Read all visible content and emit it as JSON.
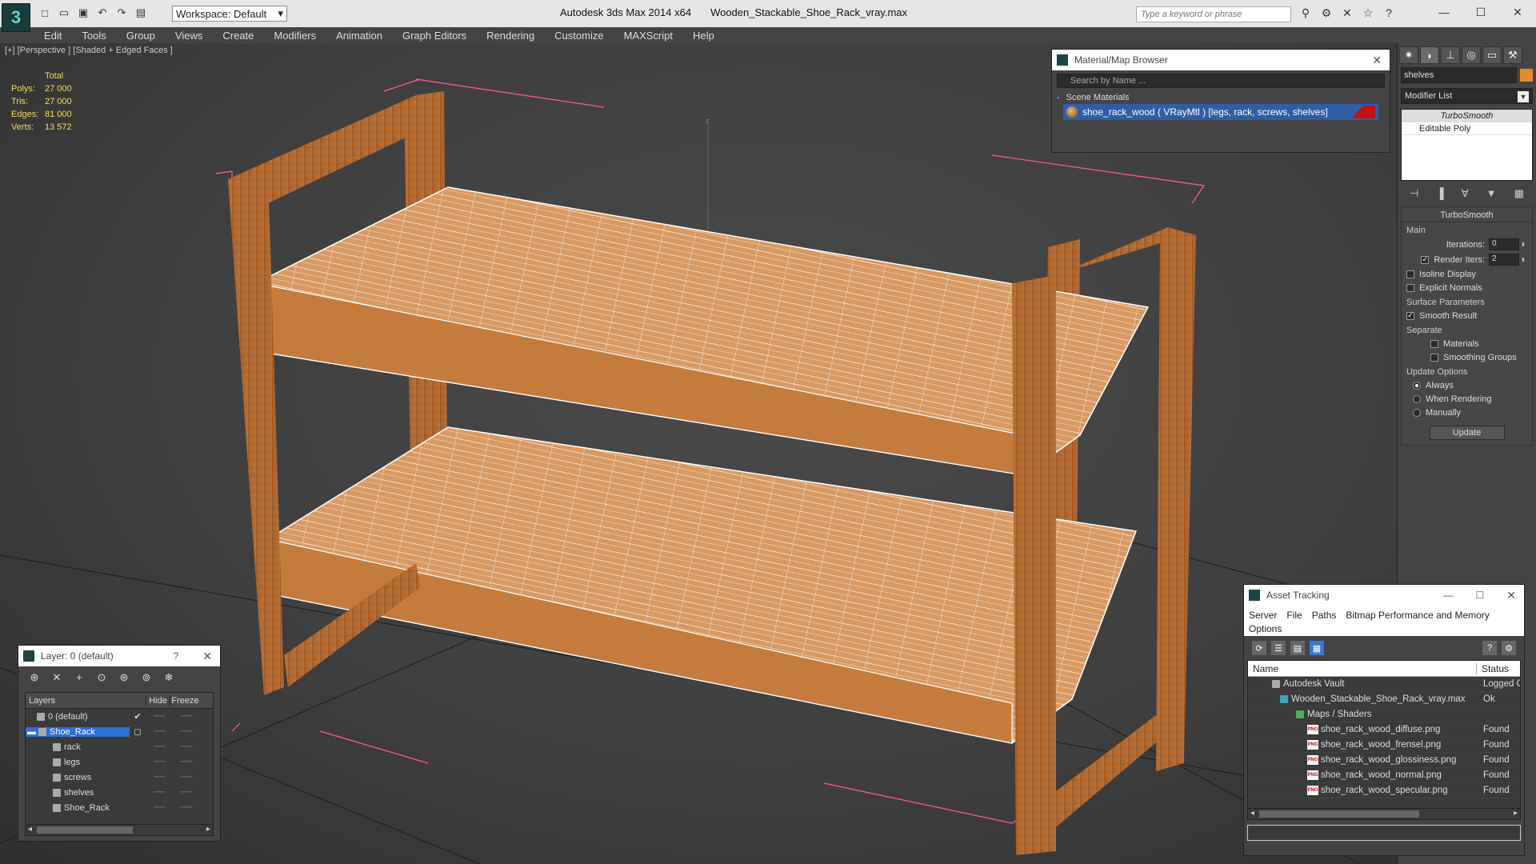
{
  "app": {
    "title": "Autodesk 3ds Max  2014 x64",
    "file": "Wooden_Stackable_Shoe_Rack_vray.max",
    "workspace": "Workspace: Default",
    "search_placeholder": "Type a keyword or phrase",
    "logo_glyph": "3"
  },
  "menu": [
    "Edit",
    "Tools",
    "Group",
    "Views",
    "Create",
    "Modifiers",
    "Animation",
    "Graph Editors",
    "Rendering",
    "Customize",
    "MAXScript",
    "Help"
  ],
  "viewport": {
    "label": "[+] [Perspective ] [Shaded + Edged Faces ]",
    "axis_label": "z",
    "stats": {
      "header": "Total",
      "rows": [
        {
          "k": "Polys:",
          "v": "27 000"
        },
        {
          "k": "Tris:",
          "v": "27 000"
        },
        {
          "k": "Edges:",
          "v": "81 000"
        },
        {
          "k": "Verts:",
          "v": "13 572"
        }
      ]
    }
  },
  "material_browser": {
    "title": "Material/Map Browser",
    "search": "Search by Name ...",
    "section": "Scene Materials",
    "material": "shoe_rack_wood  ( VRayMtl ) [legs, rack, screws, shelves]"
  },
  "command_panel": {
    "object_name": "shelves",
    "object_color": "#e58a2c",
    "modifier_list": "Modifier List",
    "stack": [
      "TurboSmooth",
      "Editable Poly"
    ],
    "turbosmooth": {
      "title": "TurboSmooth",
      "main": "Main",
      "iterations_label": "Iterations:",
      "iterations": "0",
      "render_iters_label": "Render Iters:",
      "render_iters": "2",
      "isoline": "Isoline Display",
      "explicit": "Explicit Normals",
      "surface": "Surface Parameters",
      "smooth_result": "Smooth Result",
      "separate": "Separate",
      "materials": "Materials",
      "smoothing_groups": "Smoothing Groups",
      "update_options": "Update Options",
      "always": "Always",
      "when_rendering": "When Rendering",
      "manually": "Manually",
      "update": "Update"
    }
  },
  "layers": {
    "title": "Layer: 0 (default)",
    "help": "?",
    "col_layers": "Layers",
    "col_hide": "Hide",
    "col_freeze": "Freeze",
    "rows": [
      {
        "name": "0 (default)",
        "indent": 14
      },
      {
        "name": "Shoe_Rack",
        "indent": 0
      },
      {
        "name": "rack",
        "indent": 26
      },
      {
        "name": "legs",
        "indent": 26
      },
      {
        "name": "screws",
        "indent": 26
      },
      {
        "name": "shelves",
        "indent": 26
      },
      {
        "name": "Shoe_Rack",
        "indent": 26
      }
    ]
  },
  "asset_tracking": {
    "title": "Asset Tracking",
    "menu": [
      "Server",
      "File",
      "Paths",
      "Bitmap Performance and Memory",
      "Options"
    ],
    "col_name": "Name",
    "col_status": "Status",
    "rows": [
      {
        "name": "Autodesk Vault",
        "status": "Logged Out",
        "indent": 30
      },
      {
        "name": "Wooden_Stackable_Shoe_Rack_vray.max",
        "status": "Ok",
        "indent": 40
      },
      {
        "name": "Maps / Shaders",
        "status": "",
        "indent": 60
      },
      {
        "name": "shoe_rack_wood_diffuse.png",
        "status": "Found",
        "indent": 74
      },
      {
        "name": "shoe_rack_wood_frensel.png",
        "status": "Found",
        "indent": 74
      },
      {
        "name": "shoe_rack_wood_glossiness.png",
        "status": "Found",
        "indent": 74
      },
      {
        "name": "shoe_rack_wood_normal.png",
        "status": "Found",
        "indent": 74
      },
      {
        "name": "shoe_rack_wood_specular.png",
        "status": "Found",
        "indent": 74
      }
    ]
  }
}
